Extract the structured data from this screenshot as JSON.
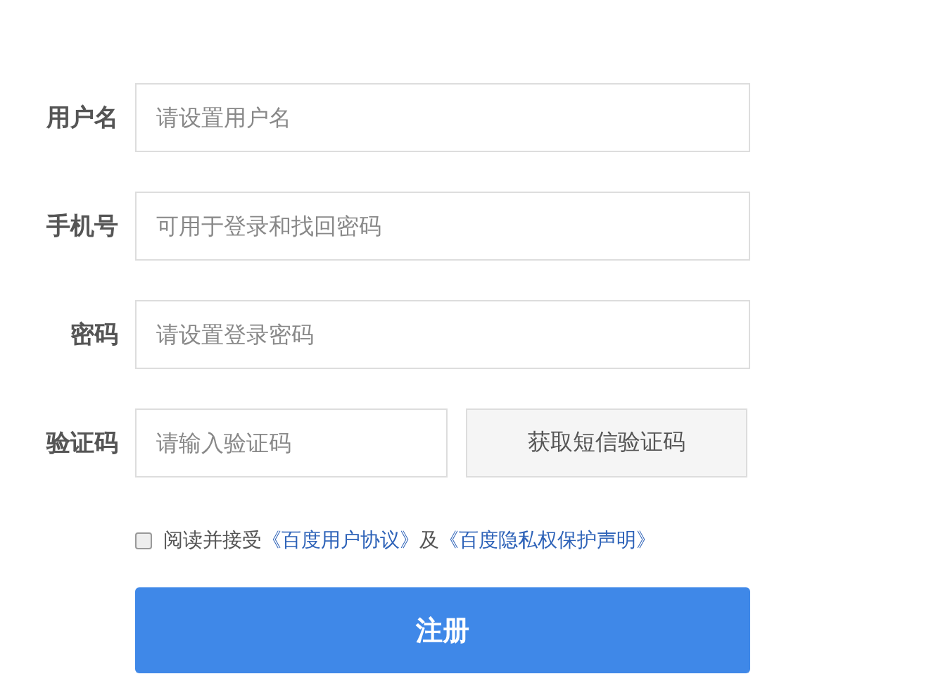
{
  "fields": [
    {
      "kind": "input",
      "label": "用户名",
      "placeholder": "请设置用户名"
    },
    {
      "kind": "input",
      "label": "手机号",
      "placeholder": "可用于登录和找回密码"
    },
    {
      "kind": "input",
      "label": "密码",
      "placeholder": "请设置登录密码"
    },
    {
      "kind": "captcha",
      "label": "验证码",
      "placeholder": "请输入验证码",
      "button": "获取短信验证码"
    }
  ],
  "agreement": {
    "checked": false,
    "parts": [
      {
        "kind": "text",
        "text": "阅读并接受"
      },
      {
        "kind": "link",
        "text": "《百度用户协议》"
      },
      {
        "kind": "text",
        "text": "及"
      },
      {
        "kind": "link",
        "text": "《百度隐私权保护声明》"
      }
    ]
  },
  "submit": "注册"
}
